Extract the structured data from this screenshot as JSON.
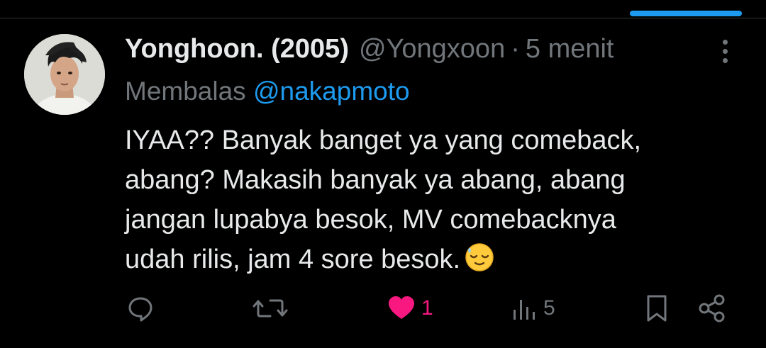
{
  "tweet": {
    "display_name": "Yonghoon. (2005)",
    "handle": "@Yongxoon",
    "separator": "·",
    "timestamp": "5 menit",
    "reply_prefix": "Membalas",
    "reply_to": "@nakapmoto",
    "text": "IYAA?? Banyak banget ya yang comeback,\nabang? Makasih banyak ya abang, abang\njangan lupabya besok, MV comebacknya\nudah rilis, jam 4 sore besok.",
    "trailing_emoji": "relieved-face-emoji"
  },
  "actions": {
    "reply_count": "",
    "retweet_count": "",
    "like_count": "1",
    "views_count": "5",
    "liked": true
  },
  "icons": [
    "reply-icon",
    "retweet-icon",
    "heart-icon",
    "views-icon",
    "bookmark-icon",
    "share-icon",
    "more-icon"
  ],
  "colors": {
    "background": "#000000",
    "text_primary": "#e7e9ea",
    "text_secondary": "#71767b",
    "accent": "#1d9bf0",
    "like": "#f91880"
  }
}
